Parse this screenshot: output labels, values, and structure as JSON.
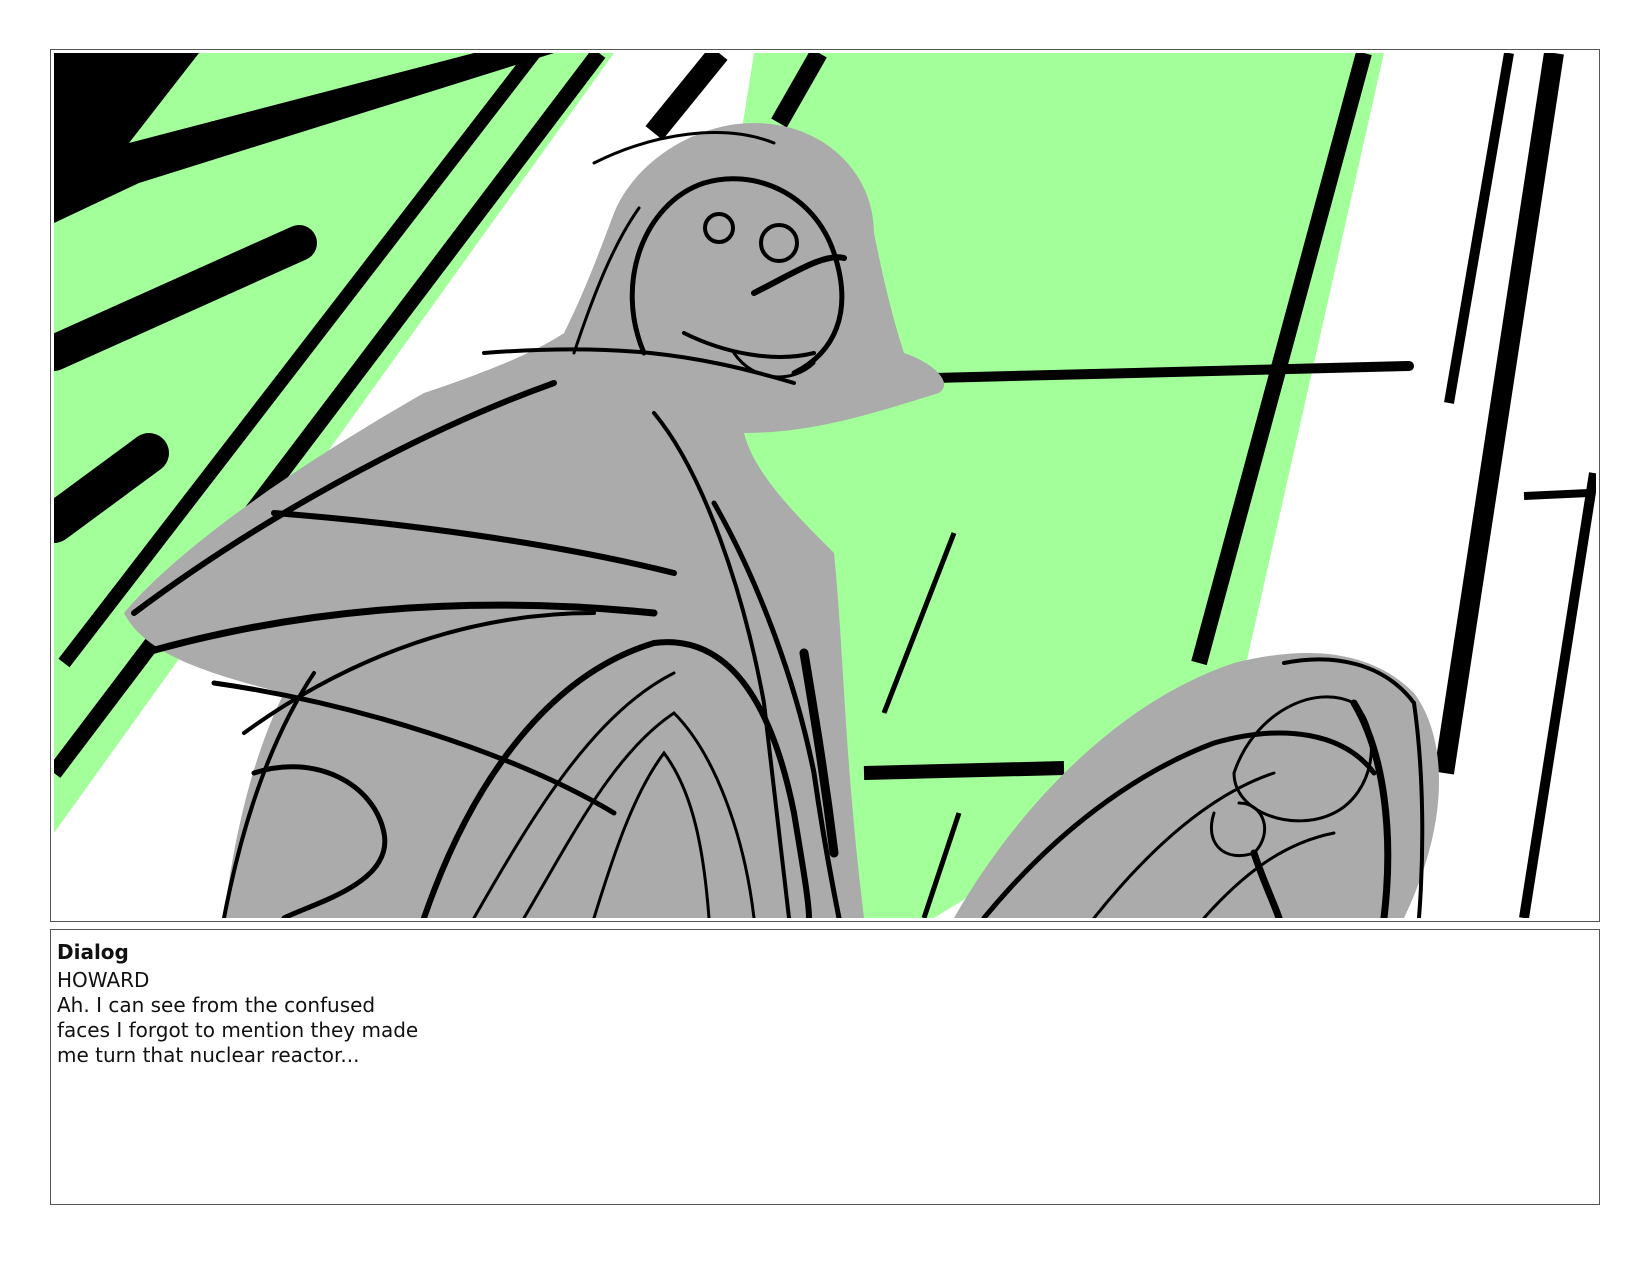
{
  "board": {
    "colors": {
      "background_fill": "#a3ff9a",
      "figure_fill": "#ababab",
      "ink": "#000000",
      "paper": "#ffffff",
      "frame_border": "#555555"
    }
  },
  "notes": {
    "heading": "Dialog",
    "lines": [
      "HOWARD",
      "Ah. I can see from the confused",
      "faces I forgot to mention they made",
      "me turn that nuclear reactor..."
    ]
  }
}
